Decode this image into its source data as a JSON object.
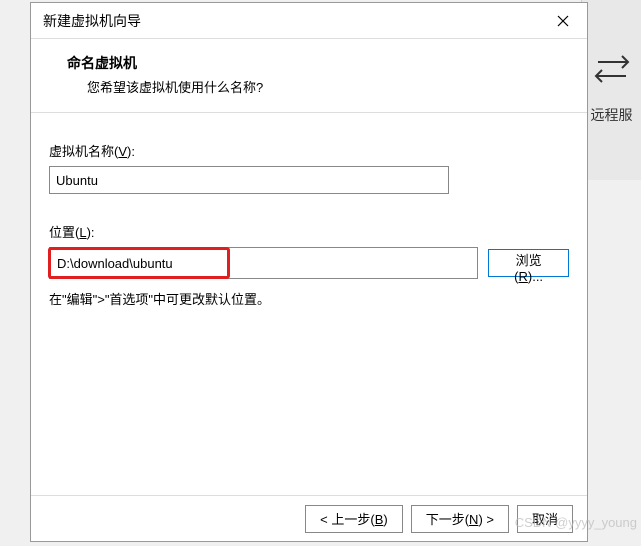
{
  "background": {
    "label": "远程服"
  },
  "dialog": {
    "title": "新建虚拟机向导",
    "header": {
      "title": "命名虚拟机",
      "subtitle": "您希望该虚拟机使用什么名称?"
    },
    "fields": {
      "name": {
        "label_prefix": "虚拟机名称(",
        "label_key": "V",
        "label_suffix": "):",
        "value": "Ubuntu"
      },
      "location": {
        "label_prefix": "位置(",
        "label_key": "L",
        "label_suffix": "):",
        "value": "D:\\download\\ubuntu",
        "browse_prefix": "浏览(",
        "browse_key": "R",
        "browse_suffix": ")..."
      },
      "hint": "在\"编辑\">\"首选项\"中可更改默认位置。"
    },
    "footer": {
      "back_prefix": "< 上一步(",
      "back_key": "B",
      "back_suffix": ")",
      "next_prefix": "下一步(",
      "next_key": "N",
      "next_suffix": ") >",
      "cancel": "取消"
    }
  },
  "watermark": "CSDN @yyyy_young"
}
